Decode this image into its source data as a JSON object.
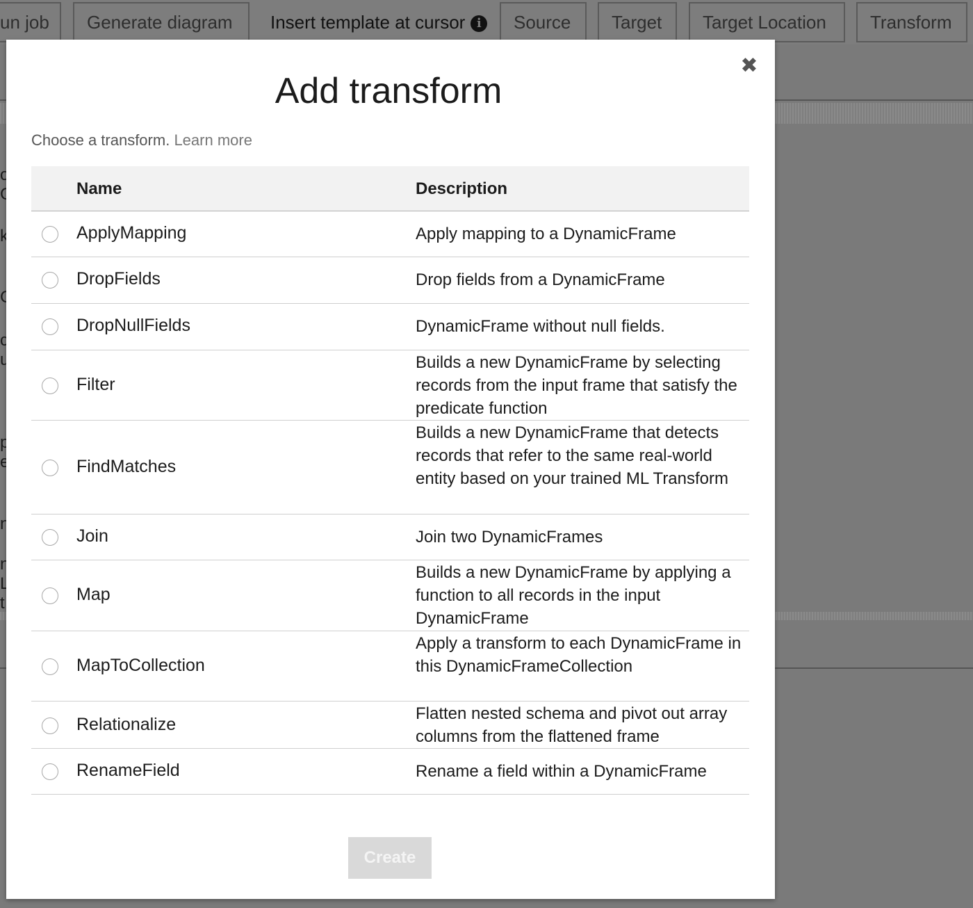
{
  "toolbar": {
    "run_job_label": "un job",
    "generate_diagram_label": "Generate diagram",
    "insert_template_label": "Insert template at cursor",
    "info_icon": "info-icon",
    "source_label": "Source",
    "target_label": "Target",
    "target_location_label": "Target Location",
    "transform_label": "Transform"
  },
  "background_edge_chars": [
    "o",
    "C",
    "k",
    "C",
    "c",
    "u",
    "p",
    "e",
    "n",
    "n",
    "L",
    "t"
  ],
  "modal": {
    "title": "Add transform",
    "close_icon": "close-icon",
    "close_glyph": "✖",
    "subtitle": "Choose a transform.",
    "learn_more": "Learn more",
    "table": {
      "headers": {
        "name": "Name",
        "description": "Description"
      },
      "rows": [
        {
          "name": "ApplyMapping",
          "description": "Apply mapping to a DynamicFrame"
        },
        {
          "name": "DropFields",
          "description": "Drop fields from a DynamicFrame"
        },
        {
          "name": "DropNullFields",
          "description": "DynamicFrame without null fields."
        },
        {
          "name": "Filter",
          "description": "Builds a new DynamicFrame by selecting records from the input frame that satisfy the predicate function"
        },
        {
          "name": "FindMatches",
          "description": "Builds a new DynamicFrame that detects records that refer to the same real-world entity based on your trained ML Transform"
        },
        {
          "name": "Join",
          "description": "Join two DynamicFrames"
        },
        {
          "name": "Map",
          "description": "Builds a new DynamicFrame by applying a function to all records in the input DynamicFrame"
        },
        {
          "name": "MapToCollection",
          "description": "Apply a transform to each DynamicFrame in this DynamicFrameCollection"
        },
        {
          "name": "Relationalize",
          "description": "Flatten nested schema and pivot out array columns from the flattened frame"
        },
        {
          "name": "RenameField",
          "description": "Rename a field within a DynamicFrame"
        }
      ]
    },
    "create_label": "Create",
    "create_enabled": false
  },
  "colors": {
    "overlay": "#7a7a7a",
    "modal_bg": "#ffffff",
    "header_bg": "#f2f2f2",
    "create_disabled_bg": "#d9d9d9"
  }
}
